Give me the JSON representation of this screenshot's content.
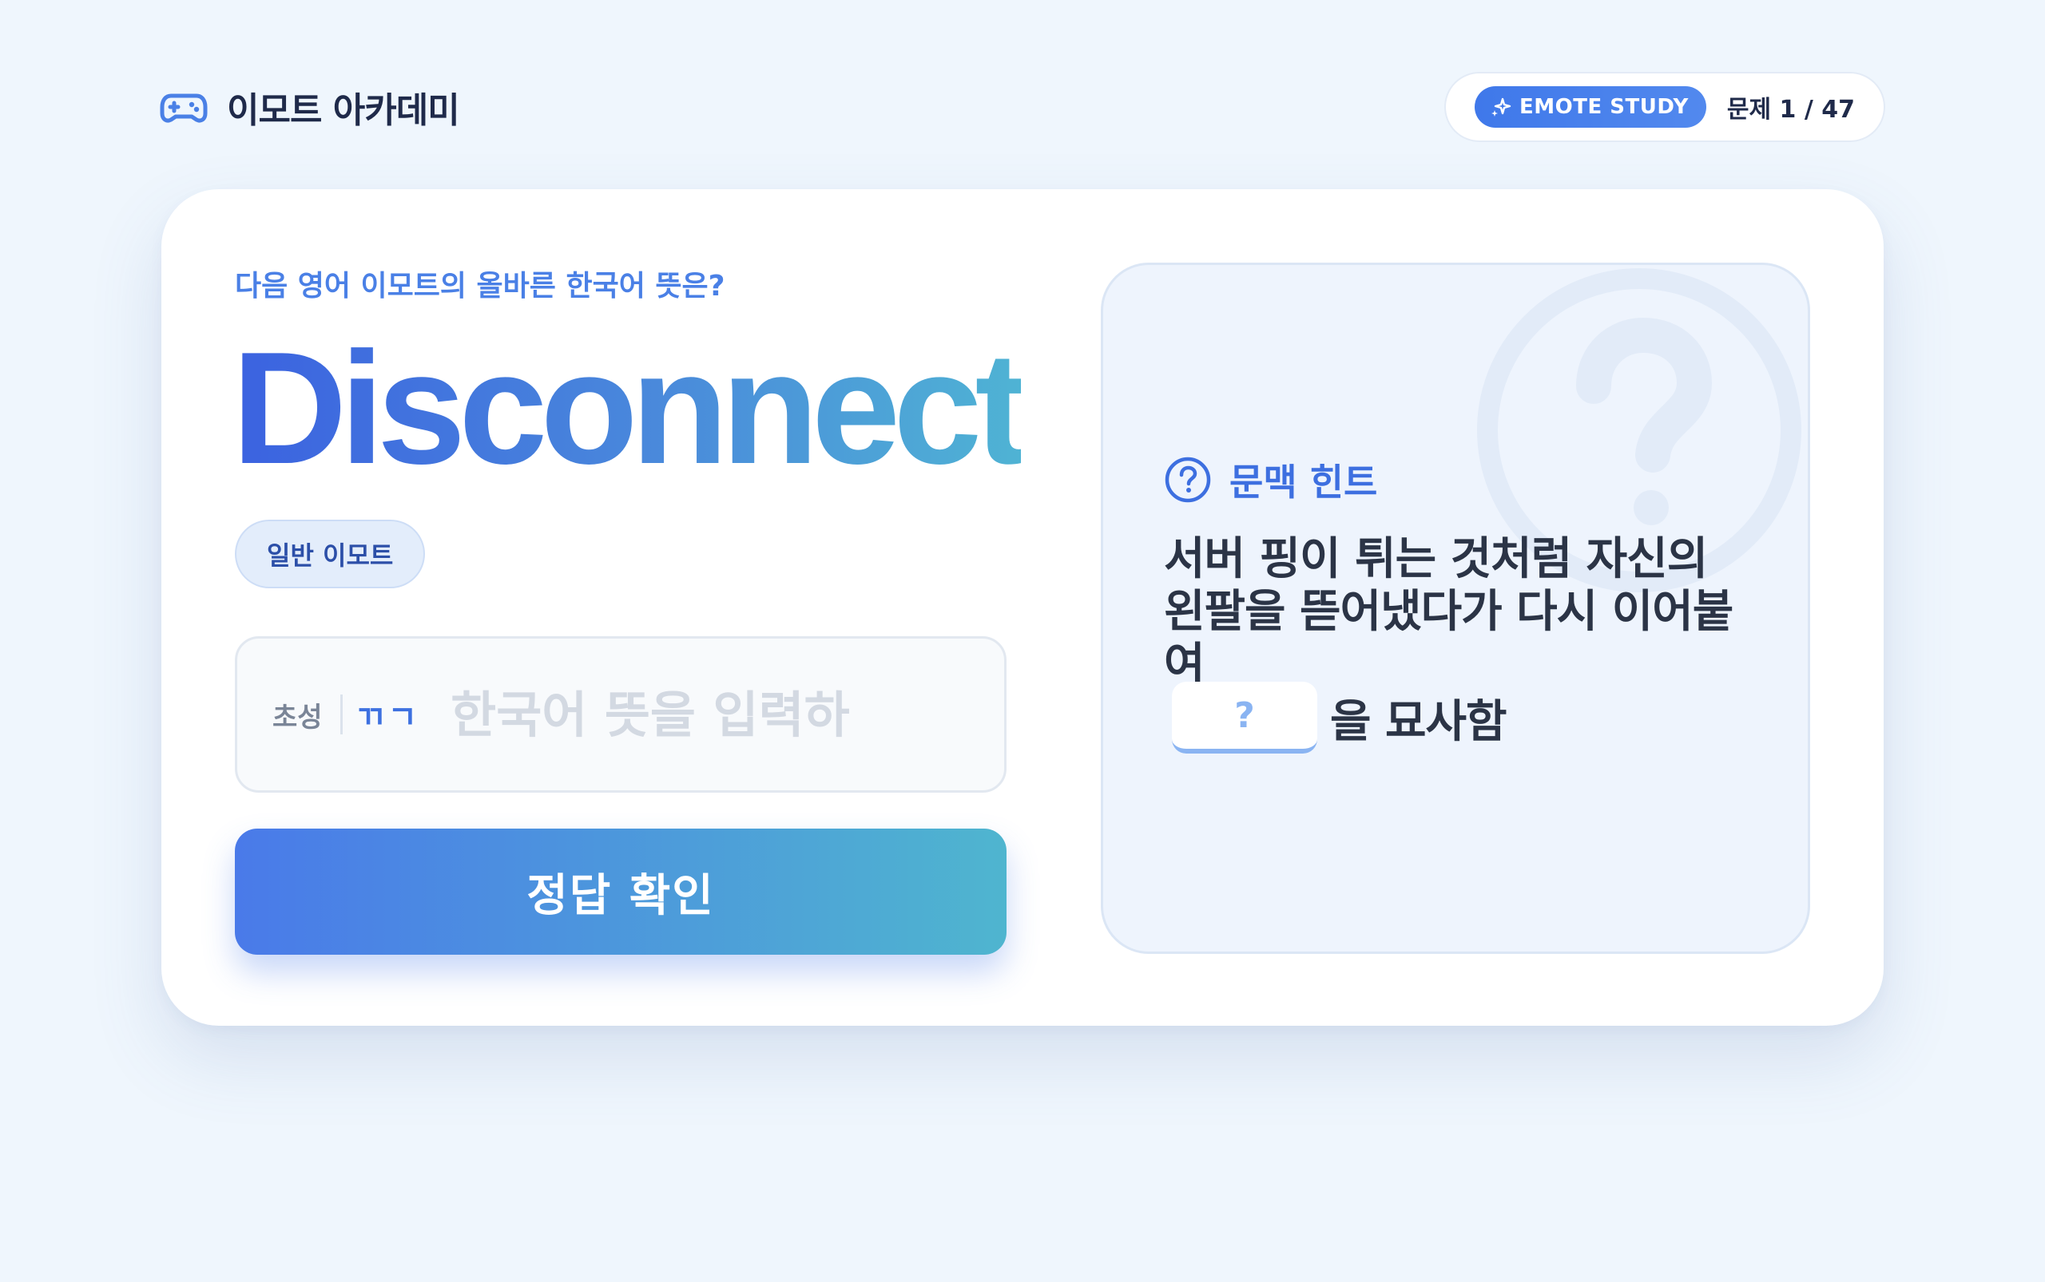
{
  "header": {
    "app_title": "이모트 아카데미",
    "app_icon": "gamepad-icon",
    "mode_badge_label": "EMOTE STUDY",
    "mode_badge_icon": "sparkle-icon",
    "counter_text": "문제 1 / 47"
  },
  "question": {
    "prompt": "다음 영어 이모트의 올바른 한국어 뜻은?",
    "word": "Disconnect",
    "type_badge": "일반 이모트"
  },
  "answer": {
    "cho_label": "초성",
    "cho_hint": "ㄲㄱ",
    "placeholder": "한국어 뜻을 입력하",
    "value": ""
  },
  "submit": {
    "label": "정답 확인"
  },
  "hint": {
    "title": "문맥 힌트",
    "icon": "question-circle-icon",
    "text": "서버 핑이 튀는 것처럼 자신의 왼팔을 뜯어냈다가 다시 이어붙여",
    "blank_mark": "?",
    "tail": "을 묘사함"
  },
  "colors": {
    "background": "#eff6fd",
    "accent": "#3f78ea",
    "accent_teal": "#4fb5cf",
    "text_dark": "#1f2a4a",
    "hint_panel": "#eef4fd"
  }
}
